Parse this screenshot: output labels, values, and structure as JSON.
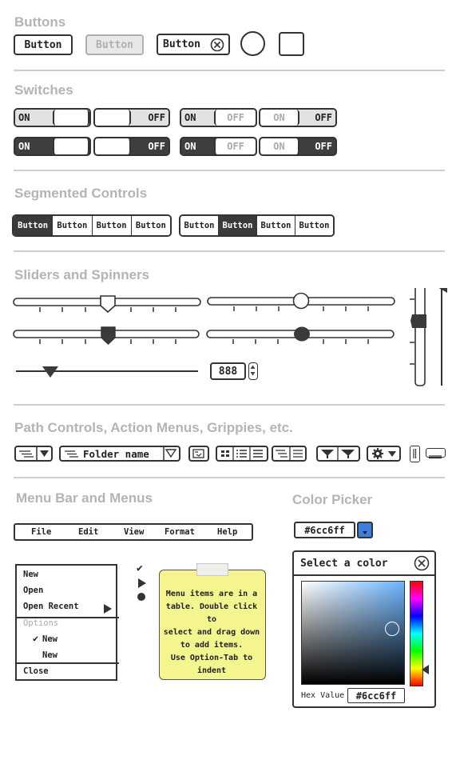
{
  "sections": {
    "buttons": "Buttons",
    "switches": "Switches",
    "segmented": "Segmented Controls",
    "sliders": "Sliders and Spinners",
    "path": "Path Controls, Action Menus, Grippies, etc.",
    "menubar": "Menu Bar and Menus",
    "colorpicker": "Color Picker"
  },
  "buttons": {
    "normal": "Button",
    "disabled": "Button",
    "with_close": "Button"
  },
  "switches": {
    "on": "ON",
    "off": "OFF"
  },
  "segmented": {
    "control1": [
      "Button",
      "Button",
      "Button",
      "Button"
    ],
    "control2": [
      "Button",
      "Button",
      "Button",
      "Button"
    ]
  },
  "spinner": {
    "value": "888"
  },
  "path_control": {
    "folder_label": "Folder name"
  },
  "menubar": {
    "items": [
      "File",
      "Edit",
      "View",
      "Format",
      "Help"
    ]
  },
  "menu": {
    "items": [
      "New",
      "Open",
      "Open Recent"
    ],
    "options_header": "Options",
    "option_checked": "New",
    "option_unchecked": "New",
    "close": "Close",
    "check_symbol": "✔"
  },
  "sticky_note": {
    "lines": [
      "Menu items are  in a",
      "table. Double click to",
      "select and drag down",
      "to add items.",
      "Use Option-Tab to",
      "indent"
    ]
  },
  "color_picker": {
    "field_value": "#6cc6ff",
    "dialog_title": "Select a color",
    "hex_label": "Hex Value",
    "hex_value": "#6cc6ff",
    "swatch_color": "#3b7fe0"
  }
}
